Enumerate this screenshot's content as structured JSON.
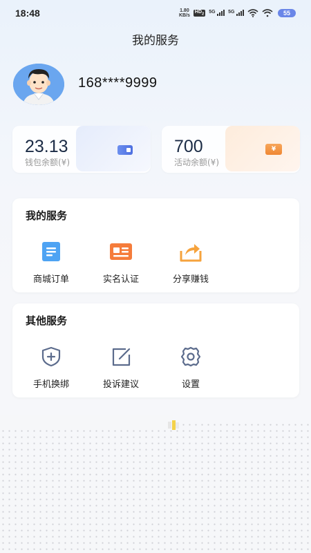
{
  "status_bar": {
    "time": "18:48",
    "net_speed_value": "1.80",
    "net_speed_unit": "KB/s",
    "hd_label": "HD",
    "hd_sub": "2",
    "sim1_label": "5G",
    "sim2_label": "5G",
    "battery": "55"
  },
  "header": {
    "title": "我的服务"
  },
  "profile": {
    "phone": "168****9999"
  },
  "balances": [
    {
      "value": "23.13",
      "label": "钱包余额(¥)",
      "icon": "wallet-icon"
    },
    {
      "value": "700",
      "label": "活动余额(¥)",
      "icon": "coin-icon",
      "icon_symbol": "¥"
    }
  ],
  "my_services": {
    "title": "我的服务",
    "items": [
      {
        "label": "商城订单",
        "icon": "order-list-icon",
        "color": "#4ea3f3"
      },
      {
        "label": "实名认证",
        "icon": "id-card-icon",
        "color": "#f57c3b"
      },
      {
        "label": "分享赚钱",
        "icon": "share-icon",
        "color": "#f6a33d"
      }
    ]
  },
  "other_services": {
    "title": "其他服务",
    "items": [
      {
        "label": "手机换绑",
        "icon": "shield-plus-icon",
        "color": "#5b6b8c"
      },
      {
        "label": "投诉建议",
        "icon": "edit-square-icon",
        "color": "#5b6b8c"
      },
      {
        "label": "设置",
        "icon": "gear-icon",
        "color": "#5b6b8c"
      }
    ]
  }
}
